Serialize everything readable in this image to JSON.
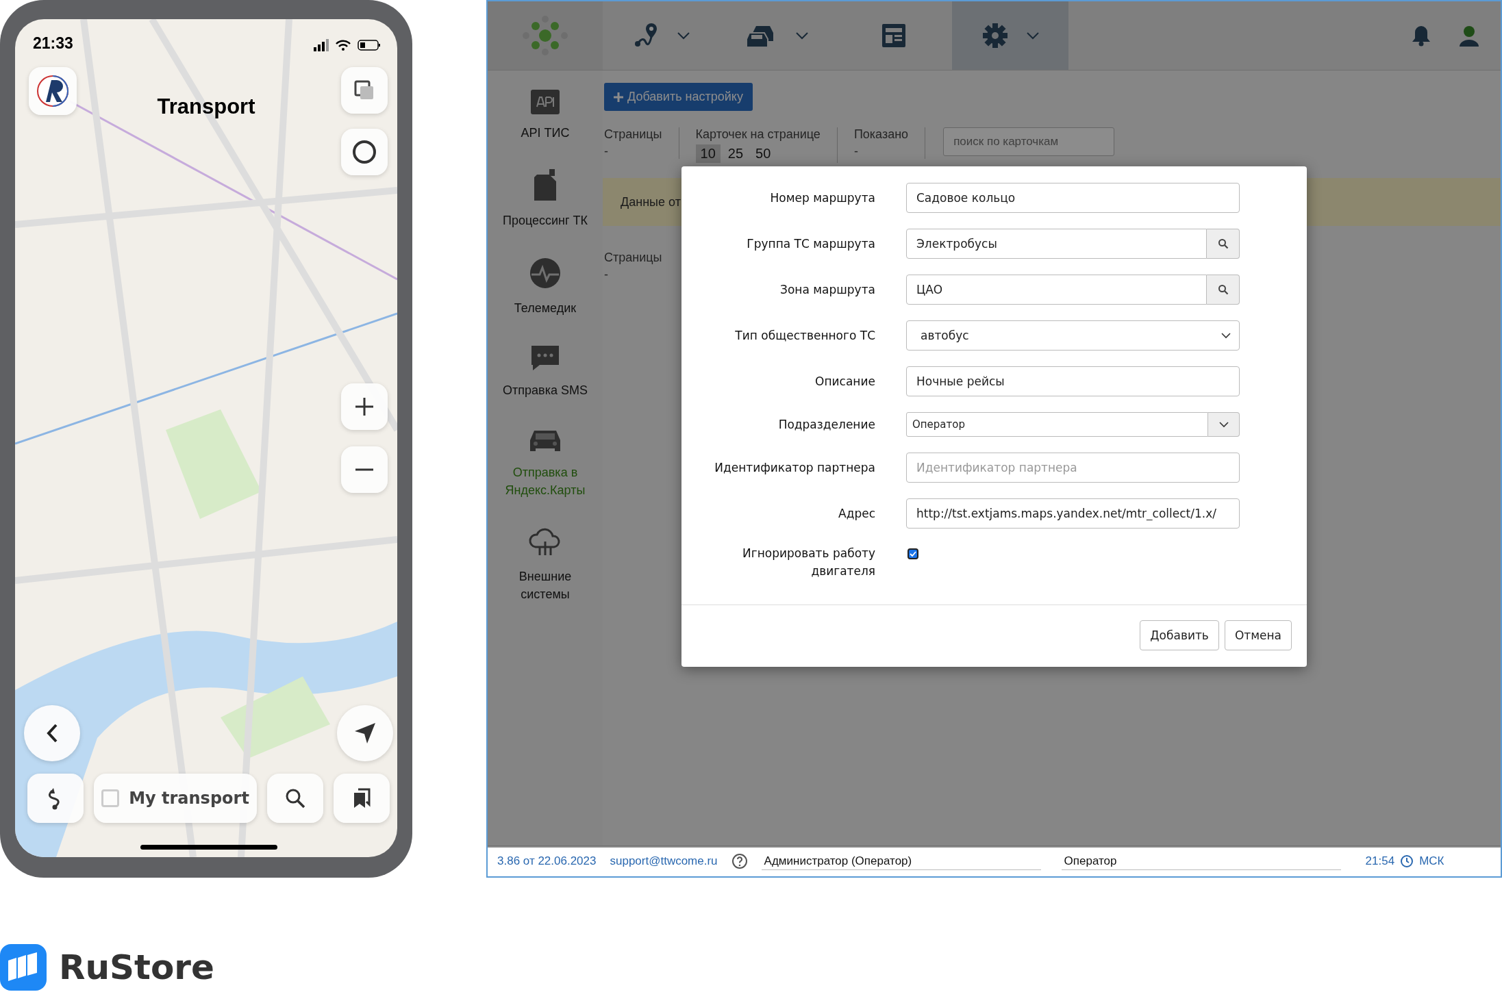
{
  "phone": {
    "status_bar": {
      "time": "21:33"
    },
    "title": "Transport",
    "my_transport": {
      "label": "My transport",
      "checked": false
    }
  },
  "web_app": {
    "nav": [
      {
        "kind": "route",
        "menu": true,
        "selected": false
      },
      {
        "kind": "vehicles",
        "menu": true,
        "selected": false
      },
      {
        "kind": "report",
        "menu": false,
        "selected": false
      },
      {
        "kind": "settings",
        "menu": true,
        "selected": true
      }
    ],
    "sidebar": [
      {
        "kind": "api",
        "label": "API ТИС",
        "selected": false
      },
      {
        "kind": "canister",
        "label": "Процессинг ТК",
        "selected": false
      },
      {
        "kind": "pulse",
        "label": "Телемедик",
        "selected": false
      },
      {
        "kind": "chat",
        "label": "Отправка SMS",
        "selected": false
      },
      {
        "kind": "car",
        "label": "Отправка в Яндекс.Карты",
        "selected": true
      },
      {
        "kind": "cloud",
        "label": "Внешние системы",
        "selected": false
      }
    ],
    "add_button": "Добавить настройку",
    "pager": [
      {
        "label": "Страницы",
        "value": "-"
      },
      {
        "label": "Карточек на странице",
        "options": [
          {
            "label": "10",
            "selected": true
          },
          {
            "label": "25",
            "selected": false
          },
          {
            "label": "50",
            "selected": false
          }
        ]
      },
      {
        "label": "Показано",
        "value": "-"
      }
    ],
    "search": {
      "placeholder": "поиск по карточкам"
    },
    "notice": "Данные от",
    "pager_bottom": {
      "label": "Страницы",
      "value": "-"
    },
    "dialog": {
      "fields": [
        {
          "kind": "text",
          "label": "Номер маршрута",
          "value": "Садовое кольцо"
        },
        {
          "kind": "lookup",
          "label": "Группа ТС маршрута",
          "value": "Электробусы"
        },
        {
          "kind": "lookup",
          "label": "Зона маршрута",
          "value": "ЦАО"
        },
        {
          "kind": "select",
          "label": "Тип общественного ТС",
          "value": "автобус"
        },
        {
          "kind": "text",
          "label": "Описание",
          "value": "Ночные рейсы"
        },
        {
          "kind": "combo",
          "label": "Подразделение",
          "value": "Оператор"
        },
        {
          "kind": "text",
          "label": "Идентификатор партнера",
          "placeholder": "Идентификатор партнера"
        },
        {
          "kind": "text",
          "label": "Адрес",
          "value": "http://tst.extjams.maps.yandex.net/mtr_collect/1.x/"
        },
        {
          "kind": "checkbox",
          "label": "Игнорировать работу двигателя",
          "checked": true
        }
      ],
      "buttons": [
        "Добавить",
        "Отмена"
      ]
    },
    "status_bar": {
      "version": "3.86 от 22.06.2023",
      "email": "support@ttwcome.ru",
      "user": "Администратор (Оператор)",
      "division": "Оператор",
      "time": "21:54",
      "timezone": "МСК"
    }
  },
  "brand": {
    "name": "RuStore"
  }
}
